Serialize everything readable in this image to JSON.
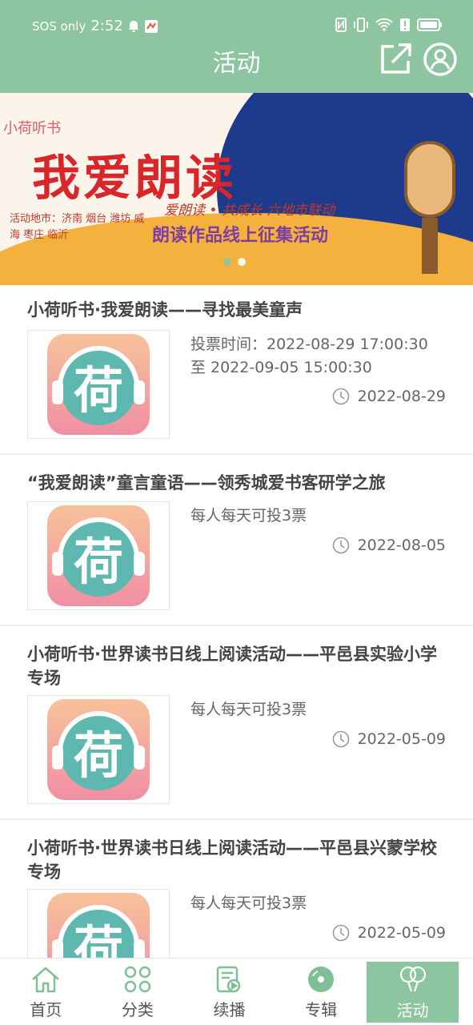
{
  "status_bar": {
    "carrier": "SOS only",
    "time": "2:52"
  },
  "header": {
    "title": "活动",
    "share_icon": "share-icon",
    "profile_icon": "user-icon"
  },
  "banner": {
    "brand": "小荷听书",
    "headline": "我爱朗读",
    "cities_label": "活动地市：济南 烟台 潍坊 威海 枣庄 临沂",
    "slogan": "爱朗读 • 共成长  六地市联动",
    "subtitle": "朗读作品线上征集活动",
    "slide_count": 2,
    "active_slide": 1
  },
  "activities": [
    {
      "title": "小荷听书·我爱朗读——寻找最美童声",
      "desc_line1": "投票时间：2022-08-29 17:00:30",
      "desc_line2": "至 2022-09-05 15:00:30",
      "date": "2022-08-29"
    },
    {
      "title": "“我爱朗读”童言童语——领秀城爱书客研学之旅",
      "desc_line1": "每人每天可投3票",
      "desc_line2": "",
      "date": "2022-08-05"
    },
    {
      "title": "小荷听书·世界读书日线上阅读活动——平邑县实验小学专场",
      "desc_line1": "每人每天可投3票",
      "desc_line2": "",
      "date": "2022-05-09"
    },
    {
      "title": "小荷听书·世界读书日线上阅读活动——平邑县兴蒙学校专场",
      "desc_line1": "每人每天可投3票",
      "desc_line2": "",
      "date": "2022-05-09"
    }
  ],
  "thumbnail_char": "荷",
  "nav": {
    "home": "首页",
    "category": "分类",
    "continue": "续播",
    "album": "专辑",
    "activity": "活动"
  },
  "colors": {
    "accent": "#8cc5a0",
    "title_text": "#444444",
    "secondary_text": "#666666"
  }
}
